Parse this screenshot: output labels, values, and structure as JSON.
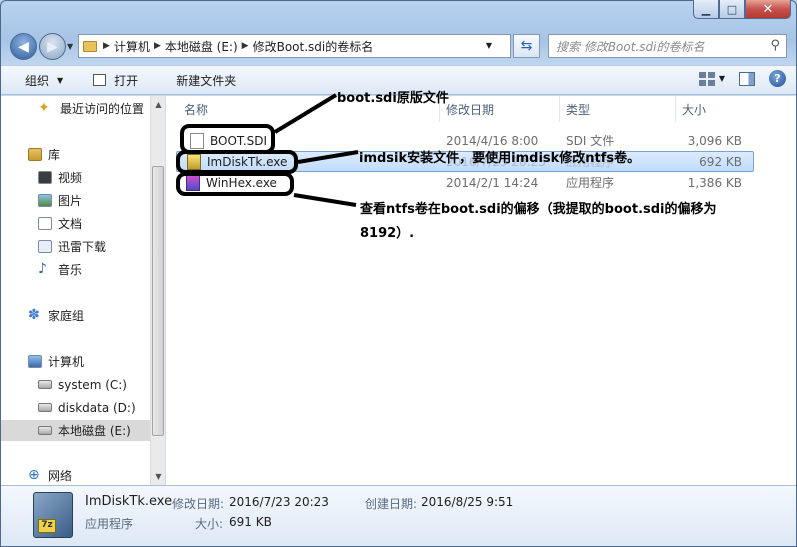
{
  "window": {
    "minimize_glyph": "▁",
    "maximize_glyph": "□",
    "close_glyph": "✕",
    "close_color": "#c75050"
  },
  "address": {
    "crumbs": [
      "计算机",
      "本地磁盘 (E:)",
      "修改Boot.sdi的卷标名"
    ]
  },
  "search": {
    "placeholder": "搜索 修改Boot.sdi的卷标名"
  },
  "toolbar": {
    "organize": "组织",
    "open": "打开",
    "new_folder": "新建文件夹"
  },
  "sidebar": {
    "items": [
      {
        "label": "最近访问的位置",
        "icon": "recent-places-icon"
      },
      {
        "label": "库",
        "icon": "library-icon"
      },
      {
        "label": "视频",
        "icon": "video-icon"
      },
      {
        "label": "图片",
        "icon": "pictures-icon"
      },
      {
        "label": "文档",
        "icon": "documents-icon"
      },
      {
        "label": "迅雷下载",
        "icon": "download-icon"
      },
      {
        "label": "音乐",
        "icon": "music-icon"
      },
      {
        "label": "家庭组",
        "icon": "homegroup-icon"
      },
      {
        "label": "计算机",
        "icon": "computer-icon"
      },
      {
        "label": "system (C:)",
        "icon": "drive-icon"
      },
      {
        "label": "diskdata (D:)",
        "icon": "drive-icon"
      },
      {
        "label": "本地磁盘 (E:)",
        "icon": "drive-icon"
      },
      {
        "label": "网络",
        "icon": "network-icon"
      }
    ],
    "selected": "本地磁盘 (E:)"
  },
  "columns": {
    "name": "名称",
    "date": "修改日期",
    "type": "类型",
    "size": "大小"
  },
  "files": [
    {
      "name": "BOOT.SDI",
      "date": "2014/4/16 8:00",
      "type": "SDI 文件",
      "size": "3,096 KB"
    },
    {
      "name": "ImDiskTk.exe",
      "date": "2016/7/23 20:23",
      "type": "应用程序",
      "size": "692 KB"
    },
    {
      "name": "WinHex.exe",
      "date": "2014/2/1 14:24",
      "type": "应用程序",
      "size": "1,386 KB"
    }
  ],
  "annotations": {
    "boot": "boot.sdi原版文件",
    "imdisk": "imdsik安装文件，要使用imdisk修改ntfs卷。",
    "winhex_line1": "查看ntfs卷在boot.sdi的偏移（我提取的boot.sdi的偏移为",
    "winhex_line2": "8192）."
  },
  "details": {
    "name": "ImDiskTk.exe",
    "modified_label": "修改日期:",
    "modified_value": "2016/7/23 20:23",
    "created_label": "创建日期:",
    "created_value": "2016/8/25 9:51",
    "type": "应用程序",
    "size_label": "大小:",
    "size_value": "691 KB"
  }
}
